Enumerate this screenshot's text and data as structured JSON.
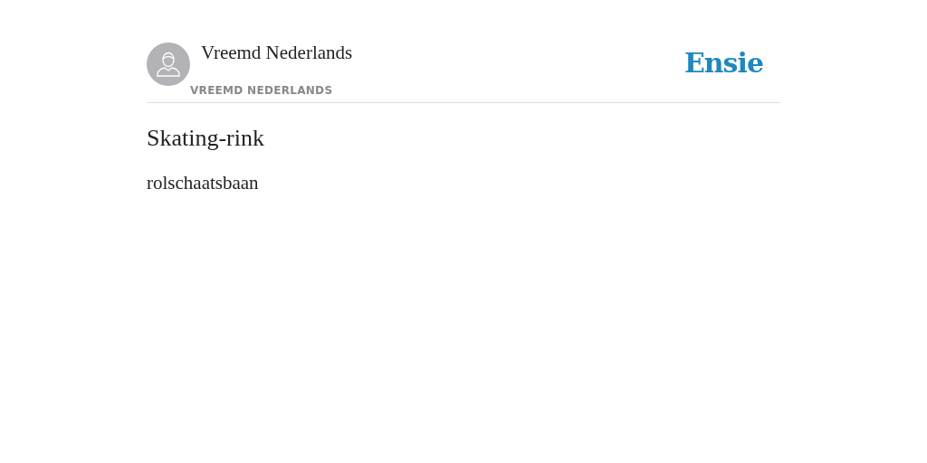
{
  "author": {
    "name": "Vreemd Nederlands",
    "category": "VREEMD NEDERLANDS"
  },
  "logo": "Ensie",
  "entry": {
    "title": "Skating-rink",
    "definition": "rolschaatsbaan"
  }
}
